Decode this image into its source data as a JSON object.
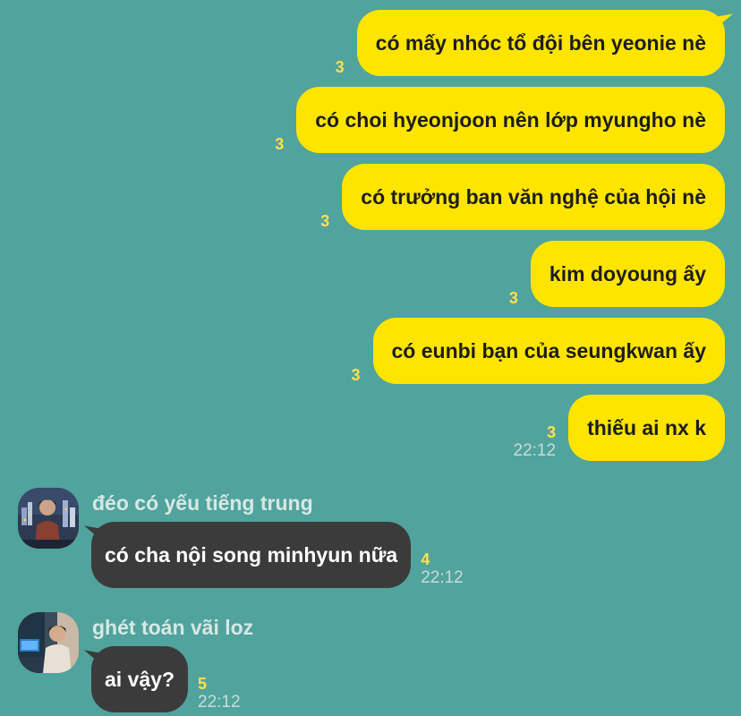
{
  "colors": {
    "background": "#51a39d",
    "outgoing_bubble": "#fee500",
    "incoming_bubble": "#3b3b3b",
    "unread_count": "#ffe14a"
  },
  "outgoing": [
    {
      "text": "có mấy nhóc tổ đội bên yeonie nè",
      "unread": "3"
    },
    {
      "text": "có choi hyeonjoon nên lớp myungho nè",
      "unread": "3"
    },
    {
      "text": "có trưởng ban văn nghệ của hội nè",
      "unread": "3"
    },
    {
      "text": "kim doyoung ấy",
      "unread": "3"
    },
    {
      "text": "có eunbi bạn của seungkwan ấy",
      "unread": "3"
    },
    {
      "text": "thiếu ai nx k",
      "unread": "3",
      "time": "22:12"
    }
  ],
  "incoming": [
    {
      "sender": "đéo có yếu tiếng trung",
      "avatar_icon": "user-avatar-icon",
      "text": "có cha nội song minhyun nữa",
      "unread": "4",
      "time": "22:12"
    },
    {
      "sender": "ghét toán vãi loz",
      "avatar_icon": "user-avatar-icon",
      "text": "ai vậy?",
      "unread": "5",
      "time": "22:12"
    }
  ]
}
